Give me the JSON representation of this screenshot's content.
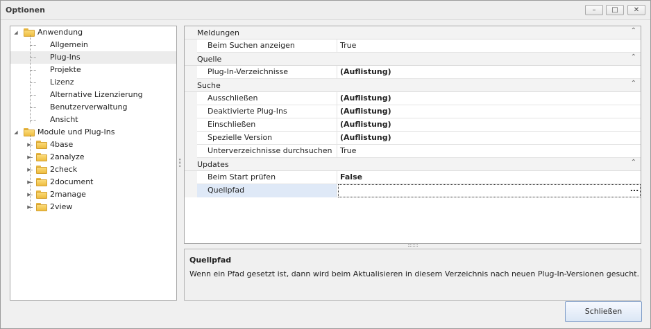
{
  "window": {
    "title": "Optionen",
    "controls": {
      "minimize": "–",
      "maximize": "□",
      "close": "✕"
    }
  },
  "tree": {
    "groups": [
      {
        "label": "Anwendung",
        "icon": "folder-icon",
        "expanded": true,
        "children": [
          "Allgemein",
          "Plug-Ins",
          "Projekte",
          "Lizenz",
          "Alternative Lizenzierung",
          "Benutzerverwaltung",
          "Ansicht"
        ]
      },
      {
        "label": "Module und Plug-Ins",
        "icon": "folder-icon",
        "expanded": true,
        "children": [
          "4base",
          "2analyze",
          "2check",
          "2document",
          "2manage",
          "2view"
        ]
      }
    ],
    "selected": "Plug-Ins"
  },
  "grid": {
    "categories": [
      {
        "label": "Meldungen",
        "rows": [
          {
            "name": "Beim Suchen anzeigen",
            "value": "True",
            "bold": false
          }
        ]
      },
      {
        "label": "Quelle",
        "rows": [
          {
            "name": "Plug-In-Verzeichnisse",
            "value": "(Auflistung)",
            "bold": true
          }
        ]
      },
      {
        "label": "Suche",
        "rows": [
          {
            "name": "Ausschließen",
            "value": "(Auflistung)",
            "bold": true
          },
          {
            "name": "Deaktivierte Plug-Ins",
            "value": "(Auflistung)",
            "bold": true
          },
          {
            "name": "Einschließen",
            "value": "(Auflistung)",
            "bold": true
          },
          {
            "name": "Spezielle Version",
            "value": "(Auflistung)",
            "bold": true
          },
          {
            "name": "Unterverzeichnisse durchsuchen",
            "value": "True",
            "bold": false
          }
        ]
      },
      {
        "label": "Updates",
        "rows": [
          {
            "name": "Beim Start prüfen",
            "value": "False",
            "bold": true
          },
          {
            "name": "Quellpfad",
            "value": "",
            "bold": false,
            "active": true,
            "button": "..."
          }
        ]
      }
    ]
  },
  "description": {
    "title": "Quellpfad",
    "text": "Wenn ein Pfad gesetzt ist, dann wird beim Aktualisieren in diesem Verzeichnis nach neuen Plug-In-Versionen gesucht."
  },
  "footer": {
    "close_label": "Schließen"
  }
}
